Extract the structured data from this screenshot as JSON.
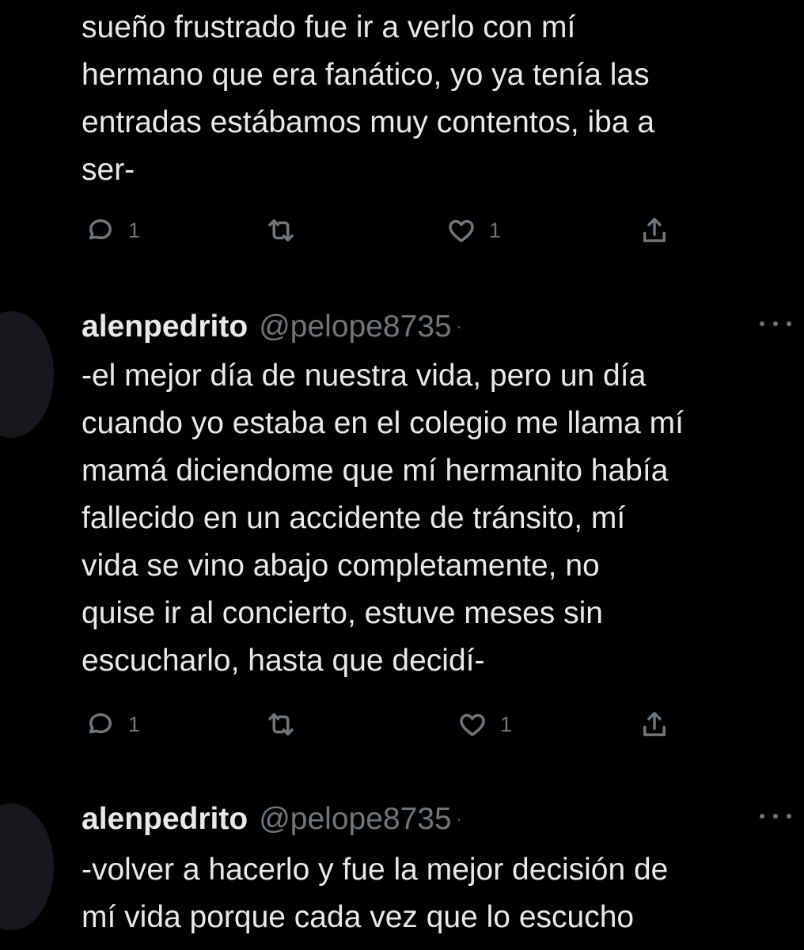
{
  "tweets": [
    {
      "text": "sueño frustrado fue ir a verlo con mí\nhermano que era fanático, yo ya tenía las\nentradas estábamos muy contentos, iba a\nser-",
      "actions": {
        "reply_count": "1",
        "retweet_count": "",
        "like_count": "1"
      }
    },
    {
      "username": "alenpedrito",
      "handle": "@pelope8735",
      "separator": "·",
      "text": "-el mejor día de nuestra vida, pero un día\ncuando yo estaba en el colegio me llama mí\nmamá diciendome que mí hermanito había\nfallecido en un accidente de tránsito, mí\nvida se vino abajo completamente, no\nquise ir al concierto, estuve meses sin\nescucharlo, hasta que decidí-",
      "actions": {
        "reply_count": "1",
        "retweet_count": "",
        "like_count": "1"
      }
    },
    {
      "username": "alenpedrito",
      "handle": "@pelope8735",
      "separator": "·",
      "text": "-volver a hacerlo y fue la mejor decisión de\nmí vida porque cada vez que lo escucho"
    }
  ],
  "icons": {
    "reply": "reply-icon",
    "retweet": "retweet-icon",
    "like": "heart-icon",
    "share": "share-icon",
    "more": "more-options-icon"
  },
  "colors": {
    "background": "#000000",
    "text": "#e7e9ea",
    "secondary": "#71767b"
  }
}
